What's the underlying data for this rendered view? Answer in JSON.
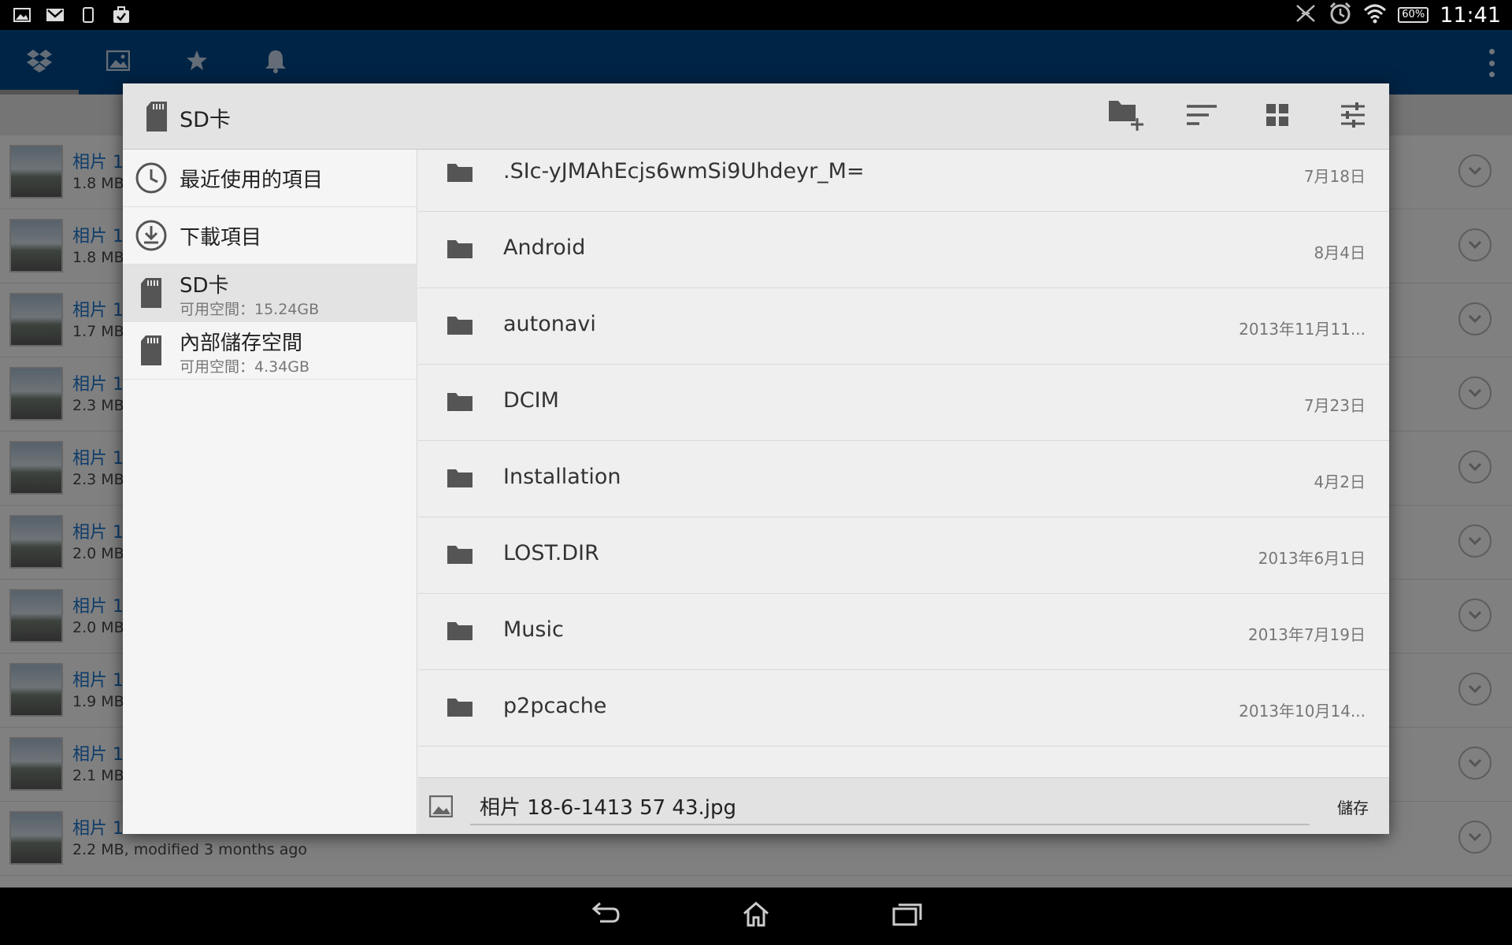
{
  "status_bar": {
    "time": "11:41",
    "battery": "60%",
    "left_icons": [
      "image-icon",
      "gmail-icon",
      "phone-icon",
      "briefcase-check-icon"
    ],
    "right_icons": [
      "mute-icon",
      "alarm-icon",
      "wifi-icon"
    ]
  },
  "app_bar": {
    "tabs": [
      {
        "icon": "dropbox-icon",
        "active": true
      },
      {
        "icon": "photos-icon",
        "active": false
      },
      {
        "icon": "star-icon",
        "active": false
      },
      {
        "icon": "bell-icon",
        "active": false
      }
    ]
  },
  "background_list": {
    "items": [
      {
        "title": "相片 1",
        "meta": "1.8 MB"
      },
      {
        "title": "相片 1",
        "meta": "1.8 MB"
      },
      {
        "title": "相片 1",
        "meta": "1.7 MB"
      },
      {
        "title": "相片 1",
        "meta": "2.3 MB"
      },
      {
        "title": "相片 1",
        "meta": "2.3 MB"
      },
      {
        "title": "相片 1",
        "meta": "2.0 MB"
      },
      {
        "title": "相片 1",
        "meta": "2.0 MB"
      },
      {
        "title": "相片 1",
        "meta": "1.9 MB"
      },
      {
        "title": "相片 1",
        "meta": "2.1 MB"
      },
      {
        "title": "相片 1",
        "meta": "2.2 MB, modified 3 months ago"
      }
    ]
  },
  "dialog": {
    "title": "SD卡",
    "actions": [
      "new-folder-icon",
      "sort-icon",
      "grid-view-icon",
      "settings-sliders-icon"
    ],
    "sidebar": [
      {
        "label": "最近使用的項目",
        "sub": "",
        "icon": "clock-icon"
      },
      {
        "label": "下載項目",
        "sub": "",
        "icon": "download-icon"
      },
      {
        "label": "SD卡",
        "sub": "可用空間：15.24GB",
        "icon": "sd-card-icon",
        "selected": true
      },
      {
        "label": "內部儲存空間",
        "sub": "可用空間：4.34GB",
        "icon": "sd-card-icon"
      }
    ],
    "files": [
      {
        "name": ".SIc-yJMAhEcjs6wmSi9Uhdeyr_M=",
        "date": "7月18日"
      },
      {
        "name": "Android",
        "date": "8月4日"
      },
      {
        "name": "autonavi",
        "date": "2013年11月11..."
      },
      {
        "name": "DCIM",
        "date": "7月23日"
      },
      {
        "name": "Installation",
        "date": "4月2日"
      },
      {
        "name": "LOST.DIR",
        "date": "2013年6月1日"
      },
      {
        "name": "Music",
        "date": "2013年7月19日"
      },
      {
        "name": "p2pcache",
        "date": "2013年10月14..."
      }
    ],
    "save_bar": {
      "filename": "相片 18-6-1413 57 43.jpg",
      "save_label": "儲存"
    }
  },
  "nav_bar": {
    "buttons": [
      "back-icon",
      "home-icon",
      "recents-icon"
    ]
  },
  "colors": {
    "app_bar": "#00427f",
    "link": "#1a6ec2",
    "dialog_bg": "#efefef"
  }
}
